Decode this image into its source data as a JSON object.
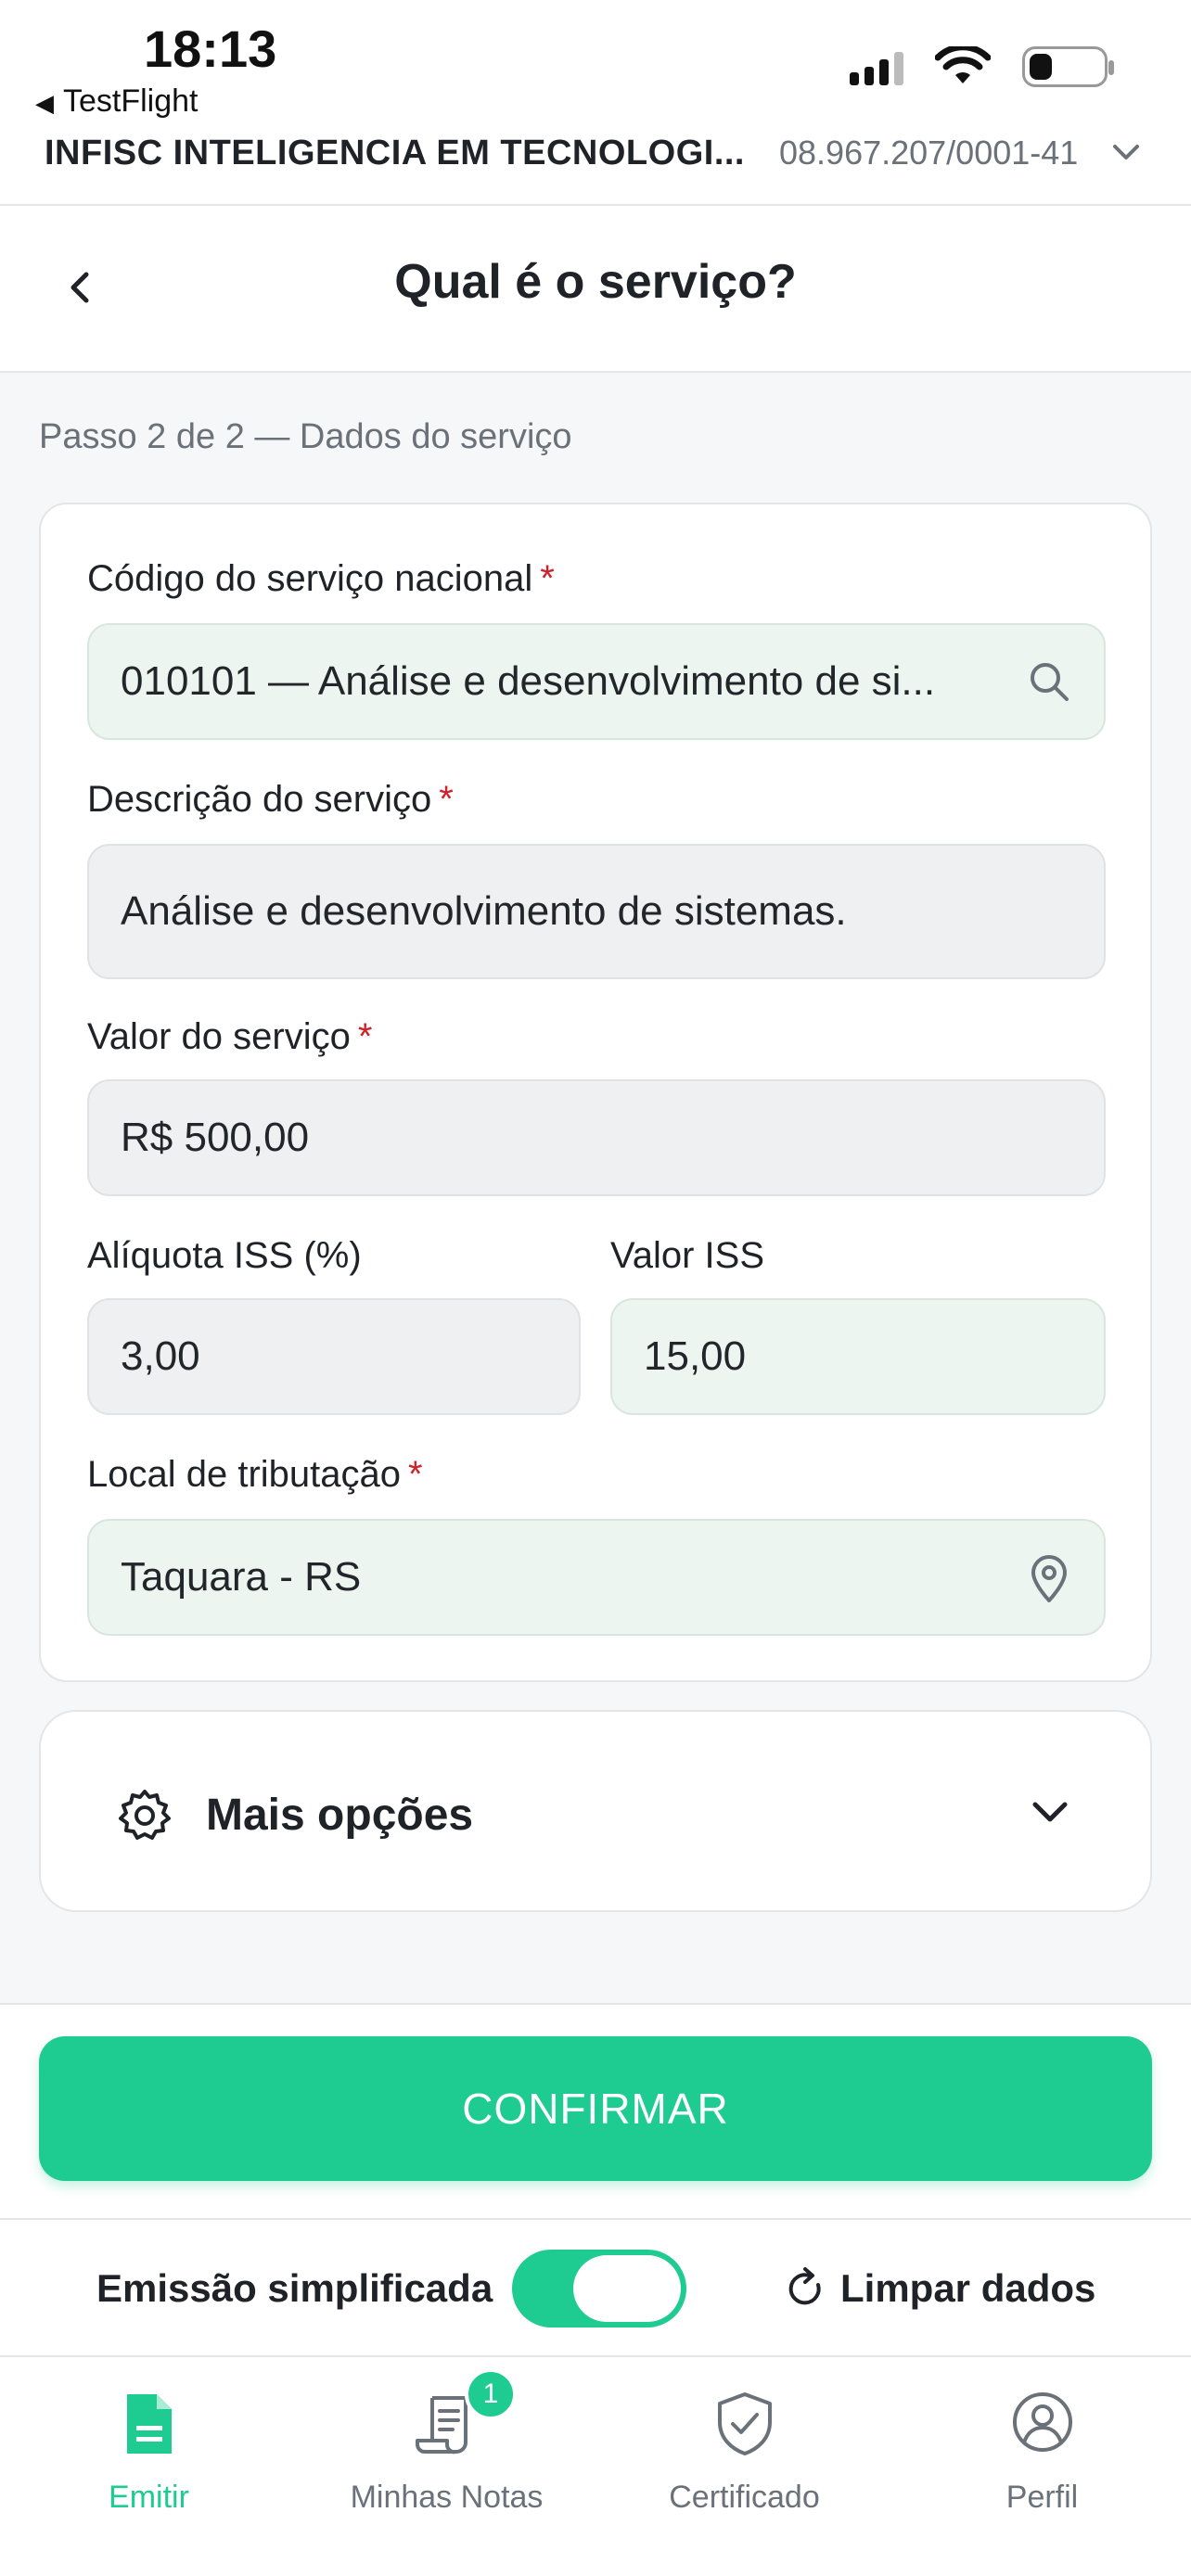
{
  "status_bar": {
    "time": "18:13",
    "back_app": "TestFlight"
  },
  "company": {
    "name": "INFISC INTELIGENCIA EM TECNOLOGI...",
    "cnpj": "08.967.207/0001-41"
  },
  "header": {
    "title": "Qual é o serviço?"
  },
  "step_text": "Passo 2 de 2 — Dados do serviço",
  "form": {
    "codigo": {
      "label": "Código do serviço nacional",
      "required": "*",
      "value": "010101 — Análise e desenvolvimento de si..."
    },
    "descricao": {
      "label": "Descrição do serviço",
      "required": "*",
      "value": "Análise e desenvolvimento de sistemas."
    },
    "valor": {
      "label": "Valor do serviço",
      "required": "*",
      "value": "R$ 500,00"
    },
    "aliquota": {
      "label": "Alíquota ISS (%)",
      "value": "3,00"
    },
    "valor_iss": {
      "label": "Valor ISS",
      "value": "15,00"
    },
    "local": {
      "label": "Local de tributação",
      "required": "*",
      "value": "Taquara - RS"
    }
  },
  "more_options": {
    "label": "Mais opções"
  },
  "footer": {
    "confirm_label": "CONFIRMAR",
    "simplified_label": "Emissão simplificada",
    "simplified_on": true,
    "clear_label": "Limpar dados"
  },
  "tabs": [
    {
      "label": "Emitir",
      "icon": "document-icon",
      "active": true
    },
    {
      "label": "Minhas Notas",
      "icon": "receipt-icon",
      "badge": "1"
    },
    {
      "label": "Certificado",
      "icon": "shield-check-icon"
    },
    {
      "label": "Perfil",
      "icon": "user-circle-icon"
    }
  ],
  "colors": {
    "accent": "#1ecb91",
    "required": "#d0202a",
    "muted_text": "#6b7178"
  }
}
